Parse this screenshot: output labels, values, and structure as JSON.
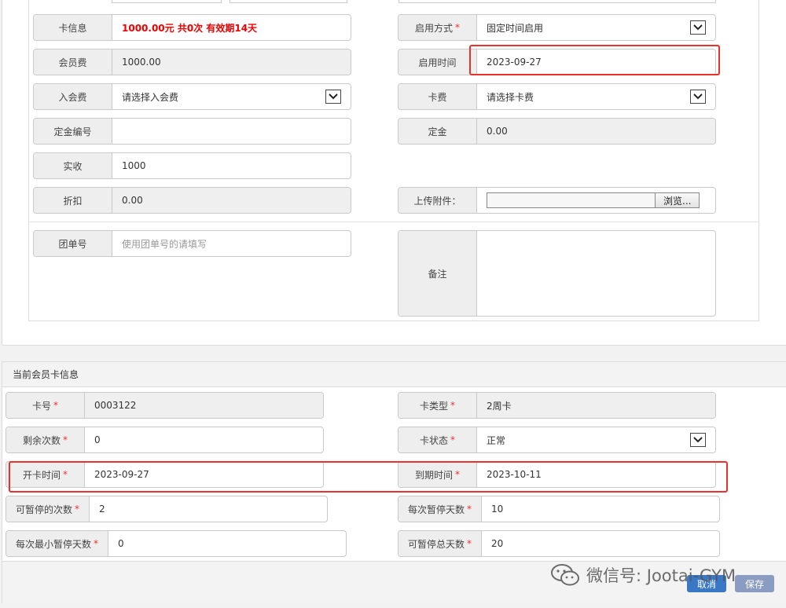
{
  "card_form": {
    "card_info": {
      "label": "卡信息",
      "value": "1000.00元 共0次 有效期14天"
    },
    "member_fee": {
      "label": "会员费",
      "value": "1000.00"
    },
    "join_fee": {
      "label": "入会费",
      "value": "请选择入会费"
    },
    "deposit_no": {
      "label": "定金编号",
      "value": ""
    },
    "received": {
      "label": "实收",
      "value": "1000"
    },
    "discount": {
      "label": "折扣",
      "value": "0.00"
    },
    "group_no": {
      "label": "团单号",
      "placeholder": "使用团单号的请填写"
    },
    "activation_mode": {
      "label": "启用方式",
      "value": "固定时间启用"
    },
    "activation_date": {
      "label": "启用时间",
      "value": "2023-09-27"
    },
    "card_fee": {
      "label": "卡费",
      "value": "请选择卡费"
    },
    "deposit": {
      "label": "定金",
      "value": "0.00"
    },
    "attachment": {
      "label": "上传附件：",
      "button": "浏览..."
    },
    "remark": {
      "label": "备注",
      "value": ""
    }
  },
  "current_card": {
    "title": "当前会员卡信息",
    "card_no": {
      "label": "卡号",
      "value": "0003122"
    },
    "card_type": {
      "label": "卡类型",
      "value": "2周卡"
    },
    "remaining_times": {
      "label": "剩余次数",
      "value": "0"
    },
    "card_status": {
      "label": "卡状态",
      "value": "正常"
    },
    "open_date": {
      "label": "开卡时间",
      "value": "2023-09-27"
    },
    "expire_date": {
      "label": "到期时间",
      "value": "2023-10-11"
    },
    "pause_times": {
      "label": "可暂停的次数",
      "value": "2"
    },
    "pause_days_each": {
      "label": "每次暂停天数",
      "value": "10"
    },
    "min_pause_days": {
      "label": "每次最小暂停天数",
      "value": "0"
    },
    "total_pause_days": {
      "label": "可暂停总天数",
      "value": "20"
    }
  },
  "actions": {
    "cancel": "取消",
    "save": "保存"
  },
  "watermark": "微信号: Jootai-GYM",
  "colors": {
    "required": "#e33333",
    "highlight": "#e8322b",
    "cancel": "#3a78c6",
    "save": "#8a9cc2"
  }
}
